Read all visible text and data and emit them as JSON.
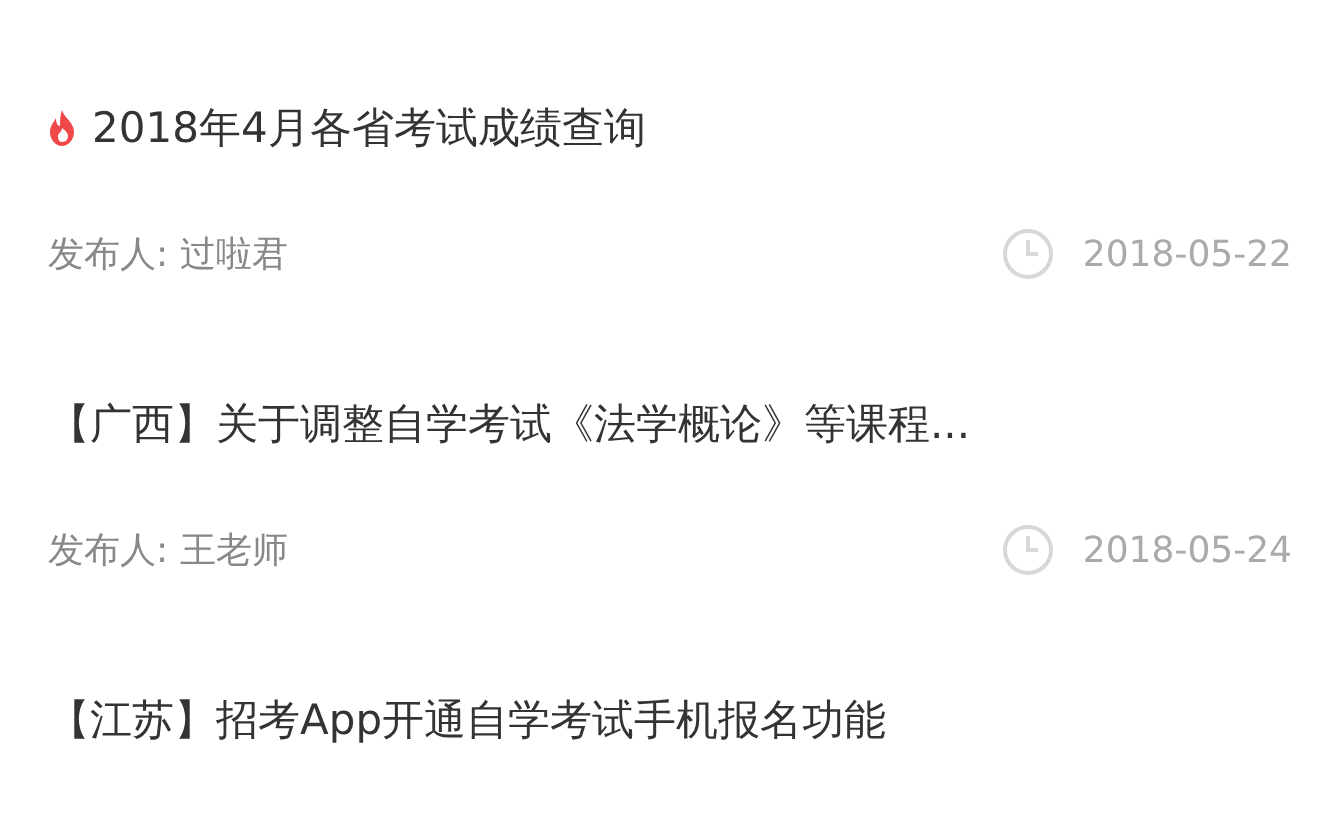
{
  "notices": [
    {
      "title": "2018年4月各省考试成绩查询",
      "hot": true,
      "author": "发布人: 过啦君",
      "date": "2018-05-22"
    },
    {
      "title": "【广西】关于调整自学考试《法学概论》等课程...",
      "hot": false,
      "author": "发布人: 王老师",
      "date": "2018-05-24"
    },
    {
      "title": "【江苏】招考App开通自学考试手机报名功能",
      "hot": false
    }
  ]
}
